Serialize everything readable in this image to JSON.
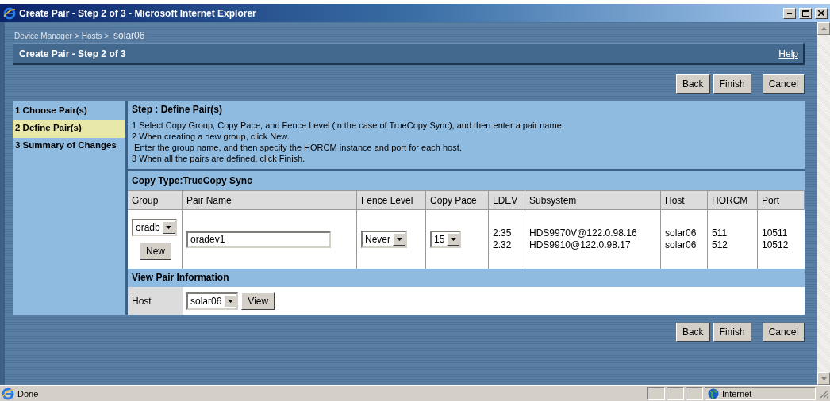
{
  "window": {
    "title": "Create Pair - Step 2 of 3 - Microsoft Internet Explorer"
  },
  "breadcrumb": {
    "links": [
      "Device Manager",
      "Hosts"
    ],
    "separator": ">",
    "current": "solar06"
  },
  "header": {
    "title": "Create Pair - Step 2 of 3",
    "help": "Help"
  },
  "top_buttons": [
    "Back",
    "Finish",
    "Cancel"
  ],
  "steps": [
    {
      "label": "1 Choose Pair(s)",
      "selected": false
    },
    {
      "label": "2 Define Pair(s)",
      "selected": true
    },
    {
      "label": "3 Summary of Changes",
      "selected": false
    }
  ],
  "step_title": "Step : Define Pair(s)",
  "instructions": [
    "1 Select Copy Group, Copy Pace, and Fence Level (in the case of TrueCopy Sync), and then enter a pair name.",
    "2 When creating a new group, click New.",
    " Enter the group name, and then specify the HORCM instance and port for each host.",
    "3 When all the pairs are defined, click Finish."
  ],
  "copy_type": "Copy Type:TrueCopy Sync",
  "table": {
    "columns": [
      "Group",
      "Pair Name",
      "Fence Level",
      "Copy Pace",
      "LDEV",
      "Subsystem",
      "Host",
      "HORCM",
      "Port"
    ],
    "row": {
      "group": "oradb",
      "new_button": "New",
      "pair_name": "oradev1",
      "fence_level": "Never",
      "copy_pace": "15",
      "ldev": [
        "2:35",
        "2:32"
      ],
      "subsystem": [
        "HDS9970V@122.0.98.16",
        "HDS9910@122.0.98.17"
      ],
      "host": [
        "solar06",
        "solar06"
      ],
      "horcm": [
        "511",
        "512"
      ],
      "port": [
        "10511",
        "10512"
      ]
    }
  },
  "view_pair": {
    "title": "View Pair Information",
    "label": "Host",
    "host": "solar06",
    "button": "View"
  },
  "bottom_buttons": [
    "Back",
    "Finish",
    "Cancel"
  ],
  "status_bar": {
    "text": "Done",
    "zone": "Internet"
  }
}
